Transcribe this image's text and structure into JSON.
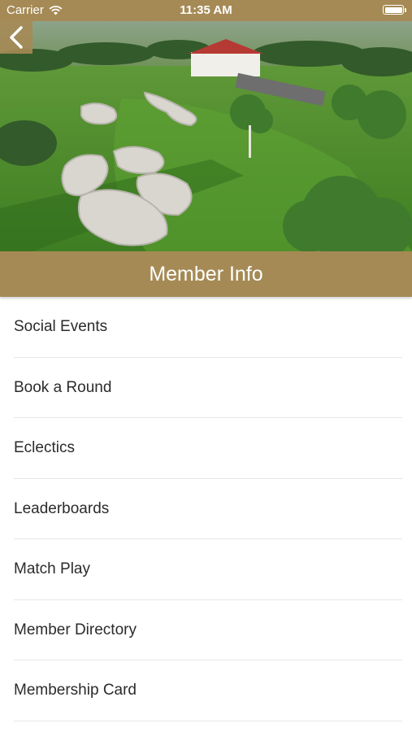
{
  "status_bar": {
    "carrier": "Carrier",
    "time": "11:35 AM"
  },
  "header": {
    "title": "Member Info"
  },
  "hero": {
    "alt": "Aerial view of golf course"
  },
  "menu": [
    {
      "label": "Social Events"
    },
    {
      "label": "Book a Round"
    },
    {
      "label": "Eclectics"
    },
    {
      "label": "Leaderboards"
    },
    {
      "label": "Match Play"
    },
    {
      "label": "Member Directory"
    },
    {
      "label": "Membership Card"
    }
  ],
  "colors": {
    "accent": "#a58a55",
    "text": "#2b2b2b",
    "divider": "#e5e5e5"
  }
}
